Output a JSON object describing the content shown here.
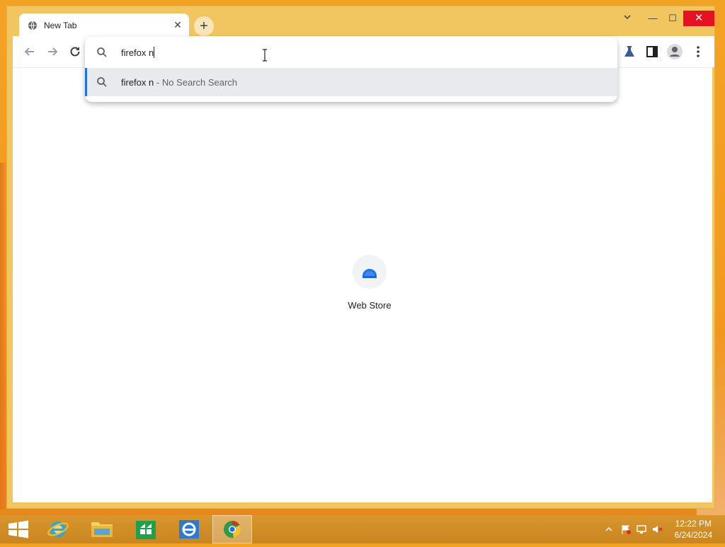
{
  "browser": {
    "tab": {
      "title": "New Tab",
      "close": "✕"
    },
    "new_tab": "+",
    "window_controls": {
      "down": "⌄",
      "minimize": "—",
      "maximize": "☐",
      "close": "✕"
    }
  },
  "omnibox": {
    "query": "firefox n",
    "suggestion": {
      "text": "firefox n",
      "separator": " - ",
      "description": "No Search Search"
    }
  },
  "shortcuts": [
    {
      "label": "Web Store"
    }
  ],
  "taskbar": {
    "clock": {
      "time": "12:22 PM",
      "date": "6/24/2024"
    }
  },
  "colors": {
    "accent": "#1a73e8",
    "desktop": "#f3a324",
    "chrome_frame": "#f1c55f",
    "close": "#e81123"
  }
}
